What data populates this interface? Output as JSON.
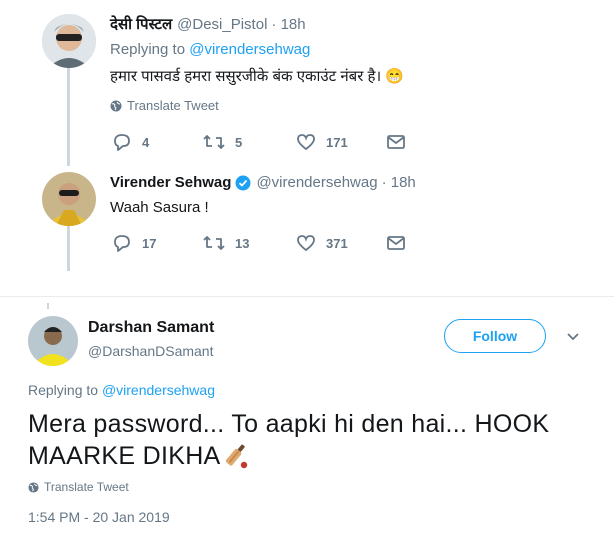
{
  "tweet1": {
    "name": "देसी पिस्टल",
    "handle": "@Desi_Pistol",
    "time": "· 18h",
    "replying_prefix": "Replying to",
    "replying_to": "@virendersehwag",
    "text": "हमार पासवर्ड हमरा ससुरजीके बंक एकाउंट नंबर है। 😁",
    "translate": "Translate Tweet",
    "replies": "4",
    "retweets": "5",
    "likes": "171"
  },
  "tweet2": {
    "name": "Virender Sehwag",
    "handle": "@virendersehwag",
    "time": "· 18h",
    "text": "Waah Sasura !",
    "replies": "17",
    "retweets": "13",
    "likes": "371"
  },
  "tweet3": {
    "name": "Darshan Samant",
    "handle": "@DarshanDSamant",
    "follow": "Follow",
    "replying_prefix": "Replying to",
    "replying_to": "@virendersehwag",
    "text_line1": "Mera password... To aapki hi den hai... HOOK",
    "text_line2": "MAARKE DIKHA",
    "translate": "Translate Tweet",
    "timestamp": "1:54 PM - 20 Jan 2019"
  },
  "colors": {
    "accent": "#1da1f2",
    "muted": "#657786",
    "line": "#ccd6dd"
  },
  "icons": [
    "reply-icon",
    "retweet-icon",
    "like-icon",
    "message-icon",
    "globe-icon",
    "verified-icon",
    "chevron-down-icon",
    "cricket-bat-emoji"
  ]
}
